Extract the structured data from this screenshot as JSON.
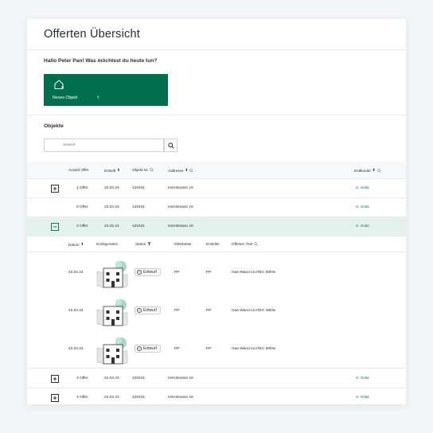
{
  "page": {
    "title": "Offerten Übersicht"
  },
  "greeting": "Hallo Peter Pan! Was möchtest du heute tun?",
  "quick_action": {
    "label": "Neues Objekt",
    "icon": "house-plus-icon",
    "color": "#006e4c"
  },
  "section_title": "Objekte",
  "search": {
    "placeholder": "Search",
    "button_icon": "search-icon"
  },
  "table": {
    "columns": [
      "Anzahl Offer.",
      "Erstellt",
      "Objekt Nr.",
      "Addresse",
      "Endkunde"
    ],
    "rows": [
      {
        "expander": "+",
        "offers": "1 Offer",
        "created": "22.02.24",
        "object_nr": "120431",
        "address": "Heizstrasse 18",
        "customer": "S. Solar"
      },
      {
        "expander": "",
        "offers": "0 Offer",
        "created": "22.02.24",
        "object_nr": "120431",
        "address": "Heizstrasse 18",
        "customer": "S. Solar"
      },
      {
        "expander": "−",
        "offers": "3 Offer",
        "created": "22.02.24",
        "object_nr": "120431",
        "address": "Heizstrasse 18",
        "customer": "S. Solar"
      },
      {
        "expander": "+",
        "offers": "3 Offer",
        "created": "22.02.24",
        "object_nr": "120431",
        "address": "Heizstrasse 18",
        "customer": "S. Solar"
      },
      {
        "expander": "+",
        "offers": "3 Offer",
        "created": "22.02.24",
        "object_nr": "120431",
        "address": "Heizstrasse 18",
        "customer": "S. Solar"
      }
    ]
  },
  "subtable": {
    "columns": [
      "Datum",
      "Konfiguration",
      "Status",
      "Mitarbeiter",
      "Ersteller",
      "Offerten Titel"
    ],
    "rows": [
      {
        "date": "22.02.24",
        "status": "Entwurf",
        "employee": "PP",
        "creator": "PP",
        "title": "Gas-Wand ecoTEC 50kW"
      },
      {
        "date": "22.02.24",
        "status": "Entwurf",
        "employee": "PP",
        "creator": "PP",
        "title": "Gas-Wand ecoTEC 45kW"
      },
      {
        "date": "22.02.24",
        "status": "Entwurf",
        "employee": "PP",
        "creator": "PP",
        "title": "Gas-Wand ecoTEC 60kW"
      }
    ]
  },
  "colors": {
    "accent": "#006e4c",
    "link": "#0b7a54",
    "active_row": "#e4f1ec"
  }
}
